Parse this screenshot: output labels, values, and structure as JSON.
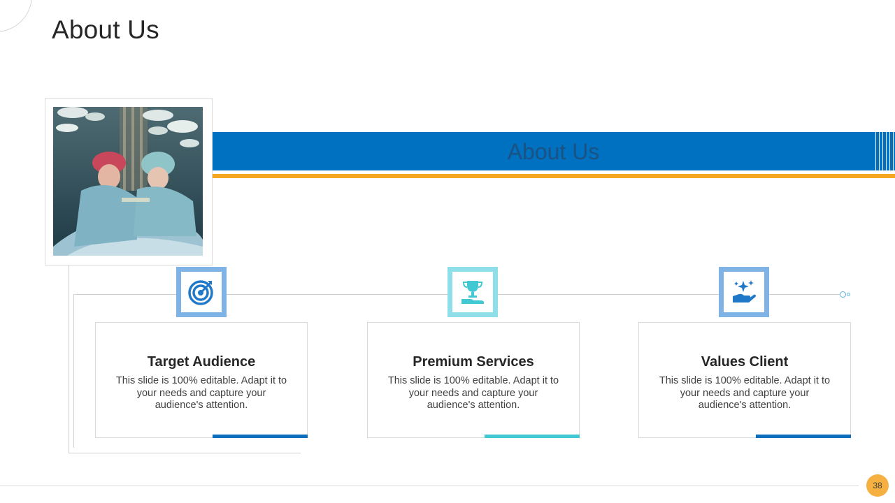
{
  "slide": {
    "title": "About Us",
    "banner_text": "About Us",
    "page_number": "38"
  },
  "colors": {
    "blue": "#0070c0",
    "orange": "#f5a623",
    "teal": "#41c8d2",
    "light_blue": "#7fb2e5"
  },
  "photo": {
    "icon": "surgeons-operating-photo"
  },
  "cards": [
    {
      "title": "Target Audience",
      "desc": "This slide is 100% editable. Adapt it to your needs and capture your audience's attention.",
      "icon": "target-icon"
    },
    {
      "title": "Premium Services",
      "desc": "This slide is 100% editable. Adapt it to your needs and capture your audience's attention.",
      "icon": "trophy-in-hand-icon"
    },
    {
      "title": "Values Client",
      "desc": "This slide is 100% editable. Adapt it to your needs and capture your audience's attention.",
      "icon": "hand-with-sparkles-icon"
    }
  ]
}
